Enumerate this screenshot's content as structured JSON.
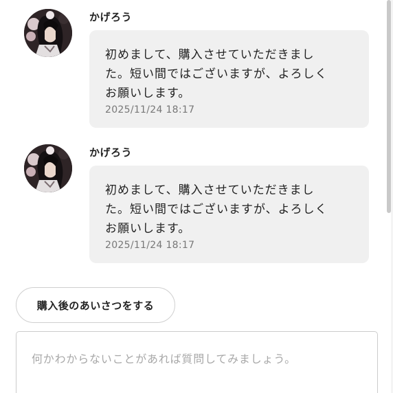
{
  "messages": [
    {
      "sender": "かげろう",
      "text": "初めまして、購入させていただきまし\nた。短い間ではございますが、よろしく\nお願いします。",
      "timestamp": "2025/11/24 18:17",
      "avatar_icon": "user-avatar-icon"
    },
    {
      "sender": "かげろう",
      "text": "初めまして、購入させていただきまし\nた。短い間ではございますが、よろしく\nお願いします。",
      "timestamp": "2025/11/24 18:17",
      "avatar_icon": "user-avatar-icon"
    }
  ],
  "greeting_button": {
    "label": "購入後のあいさつをする"
  },
  "comment": {
    "placeholder": "何かわからないことがあれば質問してみましょう。",
    "value": ""
  },
  "colors": {
    "bubble_bg": "#f0f0f0",
    "text": "#222222",
    "timestamp": "#777777",
    "border": "#cfcfcf"
  }
}
